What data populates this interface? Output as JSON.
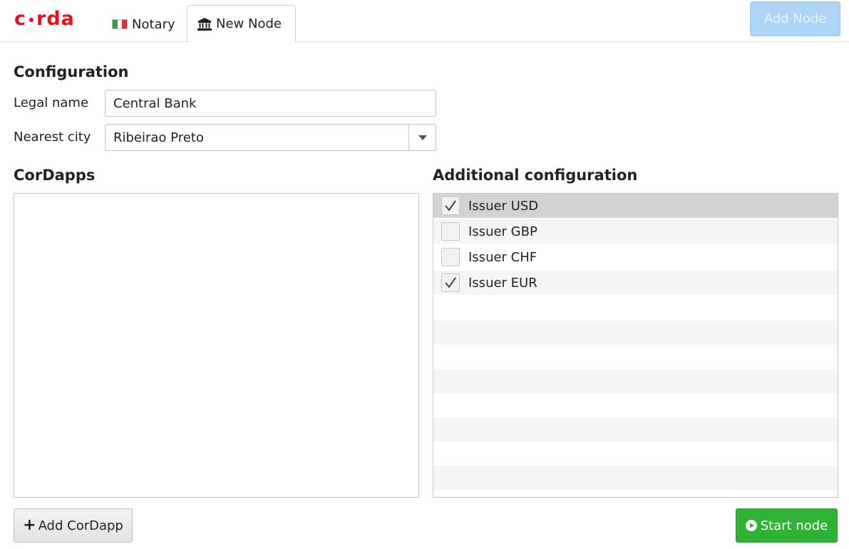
{
  "header": {
    "logo_text": "corda",
    "logo_left": "c",
    "logo_right": "rda",
    "tabs": [
      {
        "label": "Notary",
        "icon": "italy-flag-icon"
      },
      {
        "label": "New Node",
        "icon": "bank-icon"
      }
    ],
    "add_node_label": "Add Node"
  },
  "configuration": {
    "title": "Configuration",
    "legal_name_label": "Legal name",
    "legal_name_value": "Central Bank",
    "nearest_city_label": "Nearest city",
    "nearest_city_value": "Ribeirao Preto"
  },
  "cordapps": {
    "title": "CorDapps",
    "items": [],
    "add_label": "Add CorDapp"
  },
  "additional": {
    "title": "Additional configuration",
    "items": [
      {
        "label": "Issuer USD",
        "checked": true
      },
      {
        "label": "Issuer GBP",
        "checked": false
      },
      {
        "label": "Issuer CHF",
        "checked": false
      },
      {
        "label": "Issuer EUR",
        "checked": true
      }
    ]
  },
  "actions": {
    "start_node_label": "Start node"
  },
  "colors": {
    "brand_red": "#e3121c",
    "start_green": "#2fb335",
    "add_node_blue": "#aed4f7"
  }
}
